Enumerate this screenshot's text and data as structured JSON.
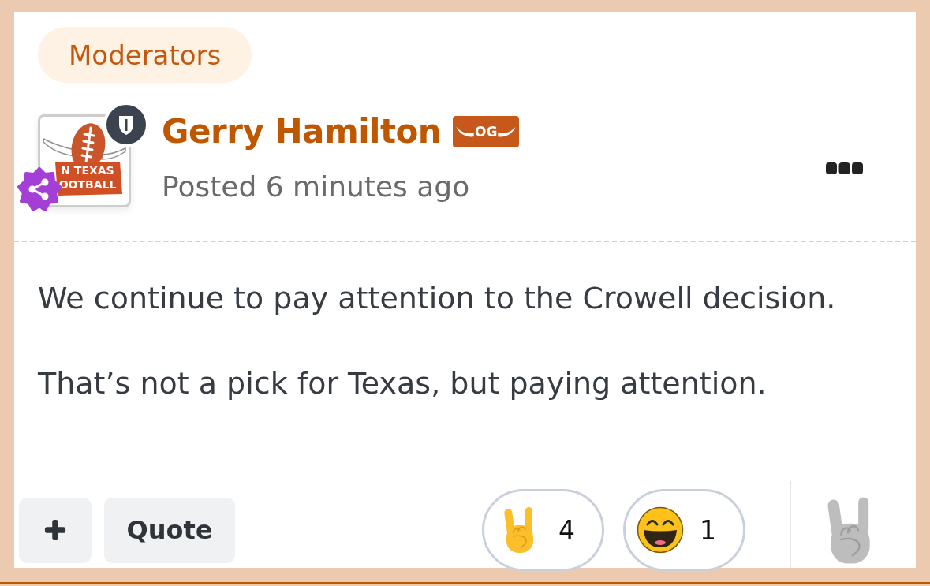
{
  "group": {
    "label": "Moderators"
  },
  "author": {
    "name": "Gerry Hamilton",
    "badge": "OG",
    "posted": "Posted 6 minutes ago",
    "avatar_text": [
      "N TEXAS",
      "OOTBALL"
    ]
  },
  "post": {
    "paragraphs": [
      "We continue to pay attention to the Crowell decision.",
      "That’s not a pick for Texas, but paying attention."
    ]
  },
  "actions": [
    {
      "kind": "plus"
    },
    {
      "kind": "text",
      "label": "Quote"
    }
  ],
  "reactions": [
    {
      "kind": "horns",
      "count": "4"
    },
    {
      "kind": "grin",
      "count": "1"
    }
  ]
}
